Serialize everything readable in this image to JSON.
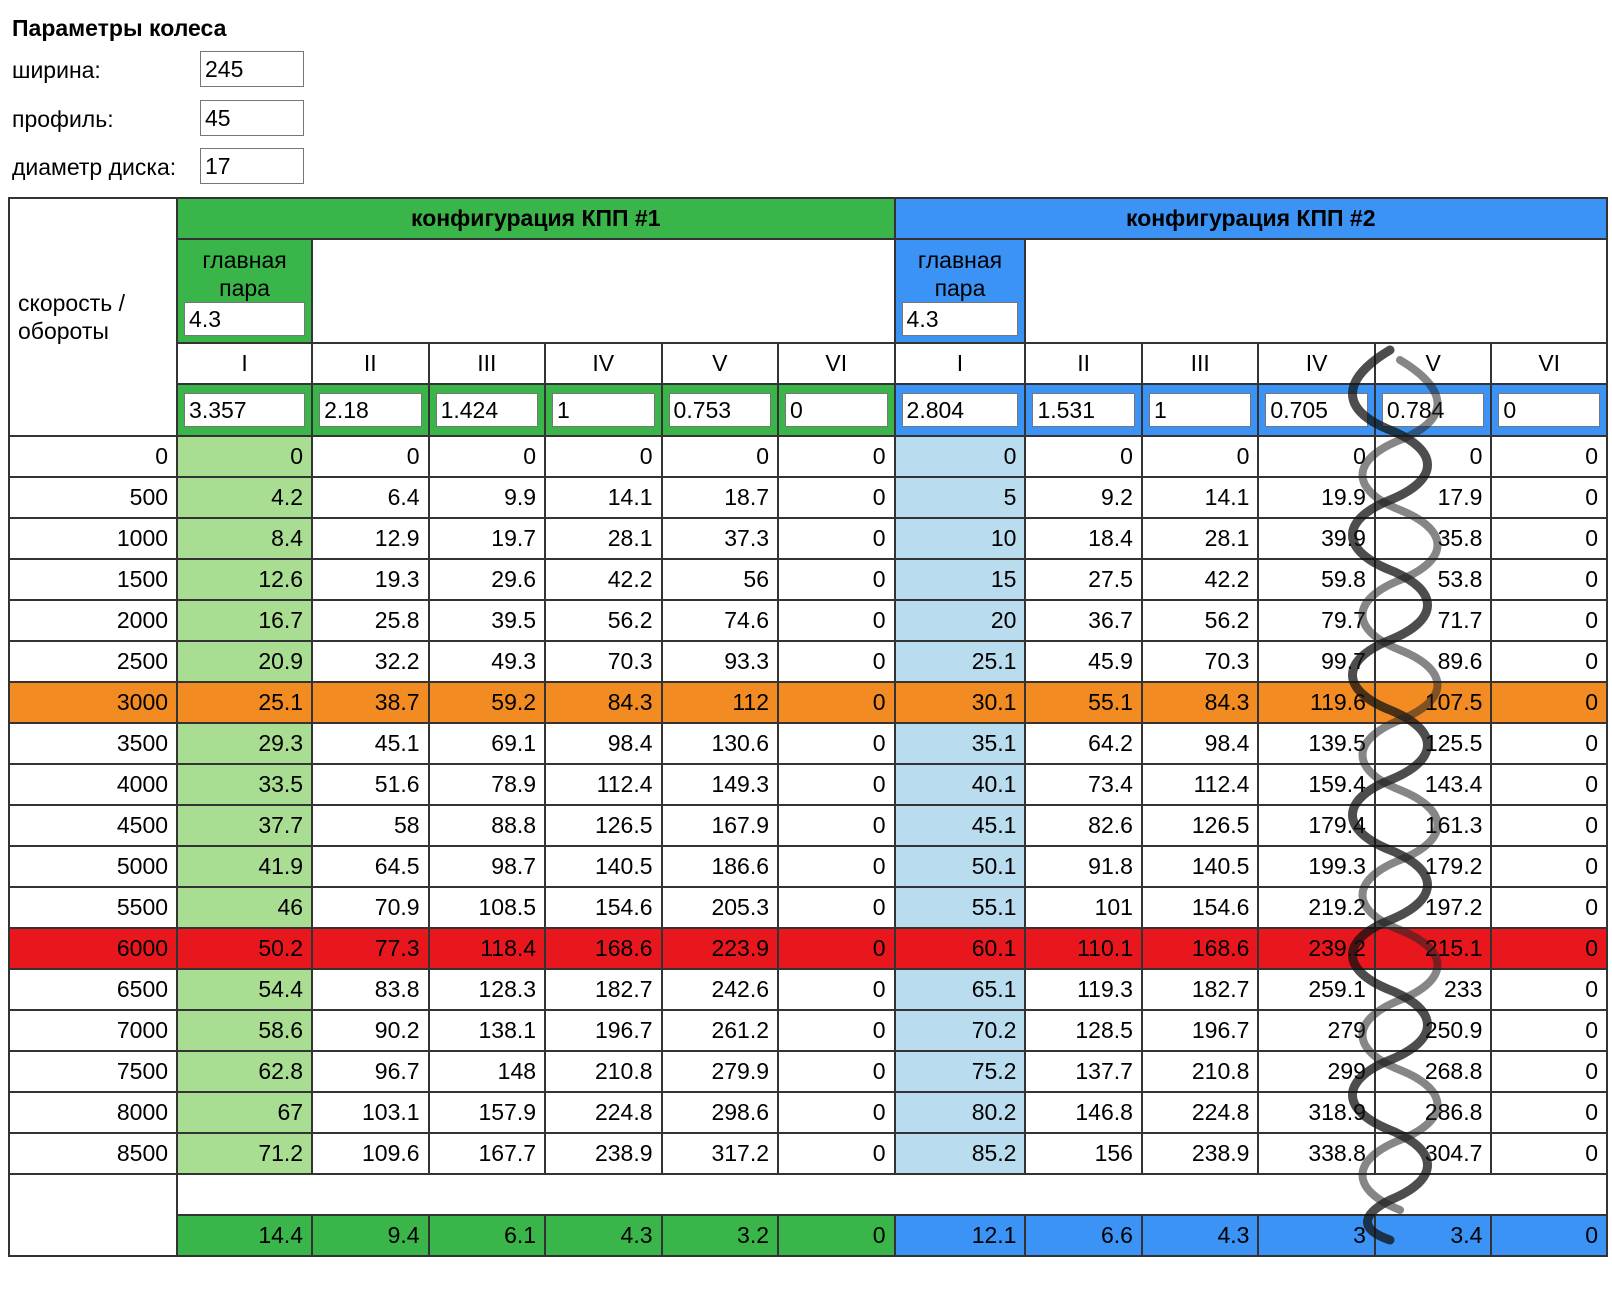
{
  "params": {
    "title": "Параметры колеса",
    "width_label": "ширина:",
    "width_value": "245",
    "profile_label": "профиль:",
    "profile_value": "45",
    "disk_label": "диаметр диска:",
    "disk_value": "17"
  },
  "table": {
    "corner_label_1": "скорость /",
    "corner_label_2": "обороты",
    "config1": {
      "title": "конфигурация КПП #1",
      "main_pair_label_1": "главная",
      "main_pair_label_2": "пара",
      "main_pair_value": "4.3",
      "gears": [
        "I",
        "II",
        "III",
        "IV",
        "V",
        "VI"
      ],
      "ratios": [
        "3.357",
        "2.18",
        "1.424",
        "1",
        "0.753",
        "0"
      ],
      "footer": [
        "14.4",
        "9.4",
        "6.1",
        "4.3",
        "3.2",
        "0"
      ]
    },
    "config2": {
      "title": "конфигурация КПП #2",
      "main_pair_label_1": "главная",
      "main_pair_label_2": "пара",
      "main_pair_value": "4.3",
      "gears": [
        "I",
        "II",
        "III",
        "IV",
        "V",
        "VI"
      ],
      "ratios": [
        "2.804",
        "1.531",
        "1",
        "0.705",
        "0.784",
        "0"
      ],
      "footer": [
        "12.1",
        "6.6",
        "4.3",
        "3",
        "3.4",
        "0"
      ]
    },
    "rows": [
      {
        "rpm": "0",
        "c1": [
          "0",
          "0",
          "0",
          "0",
          "0",
          "0"
        ],
        "c2": [
          "0",
          "0",
          "0",
          "0",
          "0",
          "0"
        ]
      },
      {
        "rpm": "500",
        "c1": [
          "4.2",
          "6.4",
          "9.9",
          "14.1",
          "18.7",
          "0"
        ],
        "c2": [
          "5",
          "9.2",
          "14.1",
          "19.9",
          "17.9",
          "0"
        ]
      },
      {
        "rpm": "1000",
        "c1": [
          "8.4",
          "12.9",
          "19.7",
          "28.1",
          "37.3",
          "0"
        ],
        "c2": [
          "10",
          "18.4",
          "28.1",
          "39.9",
          "35.8",
          "0"
        ]
      },
      {
        "rpm": "1500",
        "c1": [
          "12.6",
          "19.3",
          "29.6",
          "42.2",
          "56",
          "0"
        ],
        "c2": [
          "15",
          "27.5",
          "42.2",
          "59.8",
          "53.8",
          "0"
        ]
      },
      {
        "rpm": "2000",
        "c1": [
          "16.7",
          "25.8",
          "39.5",
          "56.2",
          "74.6",
          "0"
        ],
        "c2": [
          "20",
          "36.7",
          "56.2",
          "79.7",
          "71.7",
          "0"
        ]
      },
      {
        "rpm": "2500",
        "c1": [
          "20.9",
          "32.2",
          "49.3",
          "70.3",
          "93.3",
          "0"
        ],
        "c2": [
          "25.1",
          "45.9",
          "70.3",
          "99.7",
          "89.6",
          "0"
        ]
      },
      {
        "rpm": "3000",
        "c1": [
          "25.1",
          "38.7",
          "59.2",
          "84.3",
          "112",
          "0"
        ],
        "c2": [
          "30.1",
          "55.1",
          "84.3",
          "119.6",
          "107.5",
          "0"
        ],
        "highlight": "orange"
      },
      {
        "rpm": "3500",
        "c1": [
          "29.3",
          "45.1",
          "69.1",
          "98.4",
          "130.6",
          "0"
        ],
        "c2": [
          "35.1",
          "64.2",
          "98.4",
          "139.5",
          "125.5",
          "0"
        ]
      },
      {
        "rpm": "4000",
        "c1": [
          "33.5",
          "51.6",
          "78.9",
          "112.4",
          "149.3",
          "0"
        ],
        "c2": [
          "40.1",
          "73.4",
          "112.4",
          "159.4",
          "143.4",
          "0"
        ]
      },
      {
        "rpm": "4500",
        "c1": [
          "37.7",
          "58",
          "88.8",
          "126.5",
          "167.9",
          "0"
        ],
        "c2": [
          "45.1",
          "82.6",
          "126.5",
          "179.4",
          "161.3",
          "0"
        ]
      },
      {
        "rpm": "5000",
        "c1": [
          "41.9",
          "64.5",
          "98.7",
          "140.5",
          "186.6",
          "0"
        ],
        "c2": [
          "50.1",
          "91.8",
          "140.5",
          "199.3",
          "179.2",
          "0"
        ]
      },
      {
        "rpm": "5500",
        "c1": [
          "46",
          "70.9",
          "108.5",
          "154.6",
          "205.3",
          "0"
        ],
        "c2": [
          "55.1",
          "101",
          "154.6",
          "219.2",
          "197.2",
          "0"
        ]
      },
      {
        "rpm": "6000",
        "c1": [
          "50.2",
          "77.3",
          "118.4",
          "168.6",
          "223.9",
          "0"
        ],
        "c2": [
          "60.1",
          "110.1",
          "168.6",
          "239.2",
          "215.1",
          "0"
        ],
        "highlight": "red"
      },
      {
        "rpm": "6500",
        "c1": [
          "54.4",
          "83.8",
          "128.3",
          "182.7",
          "242.6",
          "0"
        ],
        "c2": [
          "65.1",
          "119.3",
          "182.7",
          "259.1",
          "233",
          "0"
        ]
      },
      {
        "rpm": "7000",
        "c1": [
          "58.6",
          "90.2",
          "138.1",
          "196.7",
          "261.2",
          "0"
        ],
        "c2": [
          "70.2",
          "128.5",
          "196.7",
          "279",
          "250.9",
          "0"
        ]
      },
      {
        "rpm": "7500",
        "c1": [
          "62.8",
          "96.7",
          "148",
          "210.8",
          "279.9",
          "0"
        ],
        "c2": [
          "75.2",
          "137.7",
          "210.8",
          "299",
          "268.8",
          "0"
        ]
      },
      {
        "rpm": "8000",
        "c1": [
          "67",
          "103.1",
          "157.9",
          "224.8",
          "298.6",
          "0"
        ],
        "c2": [
          "80.2",
          "146.8",
          "224.8",
          "318.9",
          "286.8",
          "0"
        ]
      },
      {
        "rpm": "8500",
        "c1": [
          "71.2",
          "109.6",
          "167.7",
          "238.9",
          "317.2",
          "0"
        ],
        "c2": [
          "85.2",
          "156",
          "238.9",
          "338.8",
          "304.7",
          "0"
        ]
      }
    ]
  },
  "colors": {
    "green": "#3ab54a",
    "blue": "#3a93f5",
    "light_green": "#a8dd92",
    "light_blue": "#b9dcef",
    "orange": "#f28c22",
    "red": "#e8171e"
  }
}
